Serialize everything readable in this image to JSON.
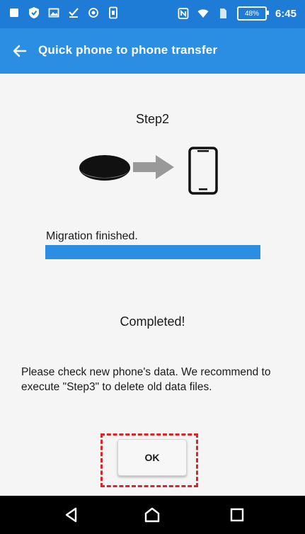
{
  "status_bar": {
    "battery_percent": "48%",
    "time": "6:45",
    "left_icons": [
      "square-notification-icon",
      "shield-icon",
      "image-icon",
      "download-done-icon",
      "record-icon",
      "phone-icon"
    ],
    "right_icons": [
      "nfc-icon",
      "wifi-icon",
      "sim-icon",
      "battery-icon"
    ]
  },
  "app_bar": {
    "title": "Quick phone to phone transfer"
  },
  "main": {
    "step_title": "Step2",
    "illustration": {
      "icons": [
        "speaker-device-icon",
        "arrow-right-icon",
        "smartphone-icon"
      ]
    },
    "migration_status": "Migration finished.",
    "progress": 1.0,
    "completed_text": "Completed!",
    "message": "Please check new phone's data. We recommend to execute \"Step3\" to delete old data files.",
    "ok_label": "OK"
  },
  "colors": {
    "status_bar": "#1e7bd6",
    "app_bar": "#2b8ee3",
    "progress": "#2b8ee3",
    "highlight": "#d62828"
  },
  "nav_bar": {
    "icons": [
      "back-triangle-icon",
      "home-icon",
      "recents-icon"
    ]
  }
}
